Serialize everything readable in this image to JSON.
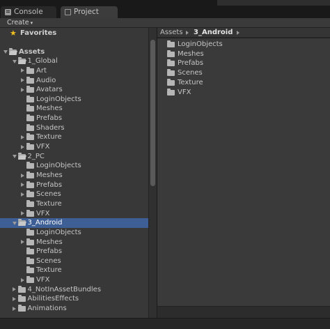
{
  "tabs": {
    "console": "Console",
    "project": "Project"
  },
  "toolbar": {
    "create_label": "Create",
    "create_caret": "▾"
  },
  "tree": {
    "favorites": "Favorites",
    "rows": [
      {
        "label": "Assets",
        "depth": 0,
        "arrow": "down",
        "open": true
      },
      {
        "label": "1_Global",
        "depth": 1,
        "arrow": "down",
        "open": true
      },
      {
        "label": "Art",
        "depth": 2,
        "arrow": "right"
      },
      {
        "label": "Audio",
        "depth": 2,
        "arrow": "right"
      },
      {
        "label": "Avatars",
        "depth": 2,
        "arrow": "right"
      },
      {
        "label": "LoginObjects",
        "depth": 2,
        "arrow": "none"
      },
      {
        "label": "Meshes",
        "depth": 2,
        "arrow": "none"
      },
      {
        "label": "Prefabs",
        "depth": 2,
        "arrow": "none"
      },
      {
        "label": "Shaders",
        "depth": 2,
        "arrow": "none"
      },
      {
        "label": "Texture",
        "depth": 2,
        "arrow": "right"
      },
      {
        "label": "VFX",
        "depth": 2,
        "arrow": "right"
      },
      {
        "label": "2_PC",
        "depth": 1,
        "arrow": "down",
        "open": true
      },
      {
        "label": "LoginObjects",
        "depth": 2,
        "arrow": "none"
      },
      {
        "label": "Meshes",
        "depth": 2,
        "arrow": "right"
      },
      {
        "label": "Prefabs",
        "depth": 2,
        "arrow": "right"
      },
      {
        "label": "Scenes",
        "depth": 2,
        "arrow": "right"
      },
      {
        "label": "Texture",
        "depth": 2,
        "arrow": "none"
      },
      {
        "label": "VFX",
        "depth": 2,
        "arrow": "right"
      },
      {
        "label": "3_Android",
        "depth": 1,
        "arrow": "down",
        "open": true,
        "selected": true
      },
      {
        "label": "LoginObjects",
        "depth": 2,
        "arrow": "none"
      },
      {
        "label": "Meshes",
        "depth": 2,
        "arrow": "right"
      },
      {
        "label": "Prefabs",
        "depth": 2,
        "arrow": "none"
      },
      {
        "label": "Scenes",
        "depth": 2,
        "arrow": "none"
      },
      {
        "label": "Texture",
        "depth": 2,
        "arrow": "none"
      },
      {
        "label": "VFX",
        "depth": 2,
        "arrow": "right"
      },
      {
        "label": "4_NotInAssetBundles",
        "depth": 1,
        "arrow": "right"
      },
      {
        "label": "AbilitiesEffects",
        "depth": 1,
        "arrow": "right"
      },
      {
        "label": "Animations",
        "depth": 1,
        "arrow": "right"
      }
    ]
  },
  "breadcrumb": {
    "items": [
      "Assets",
      "3_Android"
    ]
  },
  "content": {
    "items": [
      "LoginObjects",
      "Meshes",
      "Prefabs",
      "Scenes",
      "Texture",
      "VFX"
    ]
  },
  "colors": {
    "selection": "#3e5f96",
    "favorites_star": "#f0c020"
  }
}
